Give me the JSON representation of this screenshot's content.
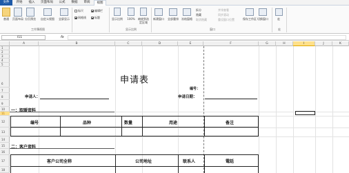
{
  "tabs": [
    "文件",
    "开始",
    "插入",
    "页面布局",
    "公式",
    "数据",
    "审阅",
    "视图"
  ],
  "ribbon": {
    "workbook_views": [
      "普通",
      "页面布局",
      "分页预览",
      "自定义视图",
      "全屏显示"
    ],
    "workbook_views_group": "工作簿视图",
    "show": [
      "标尺",
      "编辑栏",
      "网格线",
      "标题"
    ],
    "zoom": [
      "显示比例",
      "100%",
      "缩放到选定区域"
    ],
    "zoom_group": "显示比例",
    "window": [
      "新建窗口",
      "全部重排",
      "冻结窗格",
      "拆分",
      "隐藏",
      "取消隐藏",
      "并排查看",
      "同步滚动",
      "重设窗口位置",
      "保存工作区",
      "切换窗口"
    ],
    "window_group": "窗口",
    "macro": "宏",
    "macro_group": "宏"
  },
  "formula_bar": {
    "name_box": "I11",
    "fx": "fx",
    "value": ""
  },
  "columns": [
    "A",
    "B",
    "C",
    "D",
    "E",
    "F",
    "G",
    "H",
    "I",
    "J",
    "K"
  ],
  "selected_column": "I",
  "rows": [
    "1",
    "2",
    "3",
    "4",
    "5",
    "6",
    "7",
    "8",
    "9",
    "10",
    "11",
    "12",
    "13",
    "14",
    "15",
    "16",
    "17",
    "18"
  ],
  "sheet": {
    "title": "申请表",
    "number_label": "编号：",
    "applicant_label": "申请人：",
    "date_label": "申请日期：",
    "section1": "一：取暖资料",
    "table1_headers": [
      "编号",
      "品种",
      "数量",
      "用途",
      "备注"
    ],
    "section2": "二：客户资料",
    "table2_headers": [
      "客户公司全称",
      "公司地址",
      "联系人",
      "電話"
    ]
  }
}
